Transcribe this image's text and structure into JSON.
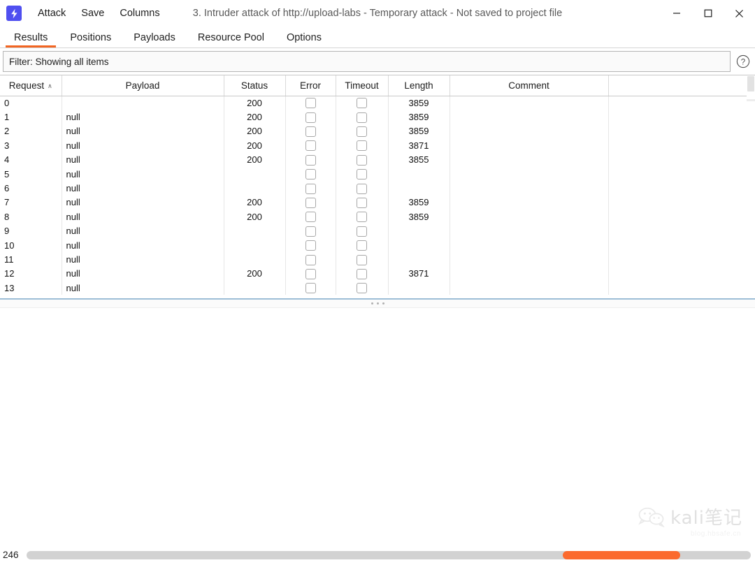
{
  "window": {
    "app_icon": "lightning-bolt-icon",
    "title": "3. Intruder attack of http://upload-labs - Temporary attack - Not saved to project file",
    "menu": [
      {
        "label": "Attack",
        "name": "menu-attack"
      },
      {
        "label": "Save",
        "name": "menu-save"
      },
      {
        "label": "Columns",
        "name": "menu-columns"
      }
    ],
    "controls": {
      "minimize": "minimize-button",
      "maximize": "maximize-button",
      "close": "close-button"
    }
  },
  "tabs": [
    {
      "label": "Results",
      "active": true
    },
    {
      "label": "Positions",
      "active": false
    },
    {
      "label": "Payloads",
      "active": false
    },
    {
      "label": "Resource Pool",
      "active": false
    },
    {
      "label": "Options",
      "active": false
    }
  ],
  "filter": {
    "text": "Filter: Showing all items",
    "help_icon": "question-mark-icon"
  },
  "table": {
    "columns": [
      "Request",
      "Payload",
      "Status",
      "Error",
      "Timeout",
      "Length",
      "Comment"
    ],
    "sort_column": "Request",
    "sort_direction": "ascending",
    "sort_caret": "∧",
    "rows": [
      {
        "request": "0",
        "payload": "",
        "status": "200",
        "error": false,
        "timeout": false,
        "length": "3859",
        "comment": ""
      },
      {
        "request": "1",
        "payload": "null",
        "status": "200",
        "error": false,
        "timeout": false,
        "length": "3859",
        "comment": ""
      },
      {
        "request": "2",
        "payload": "null",
        "status": "200",
        "error": false,
        "timeout": false,
        "length": "3859",
        "comment": ""
      },
      {
        "request": "3",
        "payload": "null",
        "status": "200",
        "error": false,
        "timeout": false,
        "length": "3871",
        "comment": ""
      },
      {
        "request": "4",
        "payload": "null",
        "status": "200",
        "error": false,
        "timeout": false,
        "length": "3855",
        "comment": ""
      },
      {
        "request": "5",
        "payload": "null",
        "status": "",
        "error": false,
        "timeout": false,
        "length": "",
        "comment": ""
      },
      {
        "request": "6",
        "payload": "null",
        "status": "",
        "error": false,
        "timeout": false,
        "length": "",
        "comment": ""
      },
      {
        "request": "7",
        "payload": "null",
        "status": "200",
        "error": false,
        "timeout": false,
        "length": "3859",
        "comment": ""
      },
      {
        "request": "8",
        "payload": "null",
        "status": "200",
        "error": false,
        "timeout": false,
        "length": "3859",
        "comment": ""
      },
      {
        "request": "9",
        "payload": "null",
        "status": "",
        "error": false,
        "timeout": false,
        "length": "",
        "comment": ""
      },
      {
        "request": "10",
        "payload": "null",
        "status": "",
        "error": false,
        "timeout": false,
        "length": "",
        "comment": ""
      },
      {
        "request": "11",
        "payload": "null",
        "status": "",
        "error": false,
        "timeout": false,
        "length": "",
        "comment": ""
      },
      {
        "request": "12",
        "payload": "null",
        "status": "200",
        "error": false,
        "timeout": false,
        "length": "3871",
        "comment": ""
      },
      {
        "request": "13",
        "payload": "null",
        "status": "",
        "error": false,
        "timeout": false,
        "length": "",
        "comment": ""
      }
    ]
  },
  "statusbar": {
    "count": "246",
    "progress_color": "#fb6a2e"
  },
  "watermark": {
    "text": "kali笔记",
    "subtext": "blog.hbsafe.cn",
    "icon": "wechat-icon"
  },
  "colors": {
    "accent": "#f26522",
    "app_icon_bg": "#4f4ff0",
    "progress": "#fb6a2e"
  }
}
